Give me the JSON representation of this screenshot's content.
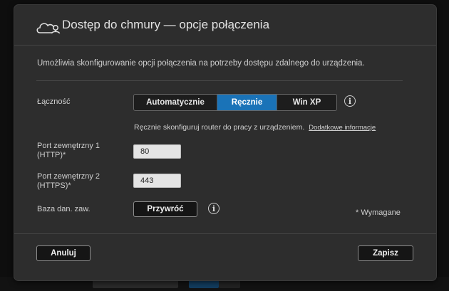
{
  "dialog": {
    "title": "Dostęp do chmury — opcje połączenia",
    "icon": "cloud-user-icon",
    "description": "Umożliwia skonfigurowanie opcji połączenia na potrzeby dostępu zdalnego do urządzenia."
  },
  "connectivity": {
    "label": "Łączność",
    "options": [
      "Automatycznie",
      "Ręcznie",
      "Win XP"
    ],
    "selected": "Ręcznie",
    "hint": "Ręcznie skonfiguruj router do pracy z urządzeniem.",
    "more_info_link": "Dodatkowe informacje"
  },
  "ports": {
    "port1_label": "Port zewnętrzny 1 (HTTP)*",
    "port1_value": "80",
    "port2_label": "Port zewnętrzny 2 (HTTPS)*",
    "port2_value": "443"
  },
  "defaults": {
    "label": "Baza dan. zaw.",
    "restore_button": "Przywróć"
  },
  "required_note": "* Wymagane",
  "footer": {
    "cancel_button": "Anuluj",
    "save_button": "Zapisz"
  },
  "colors": {
    "accent": "#1a73b8",
    "dialog_bg": "#2d2d2d"
  }
}
